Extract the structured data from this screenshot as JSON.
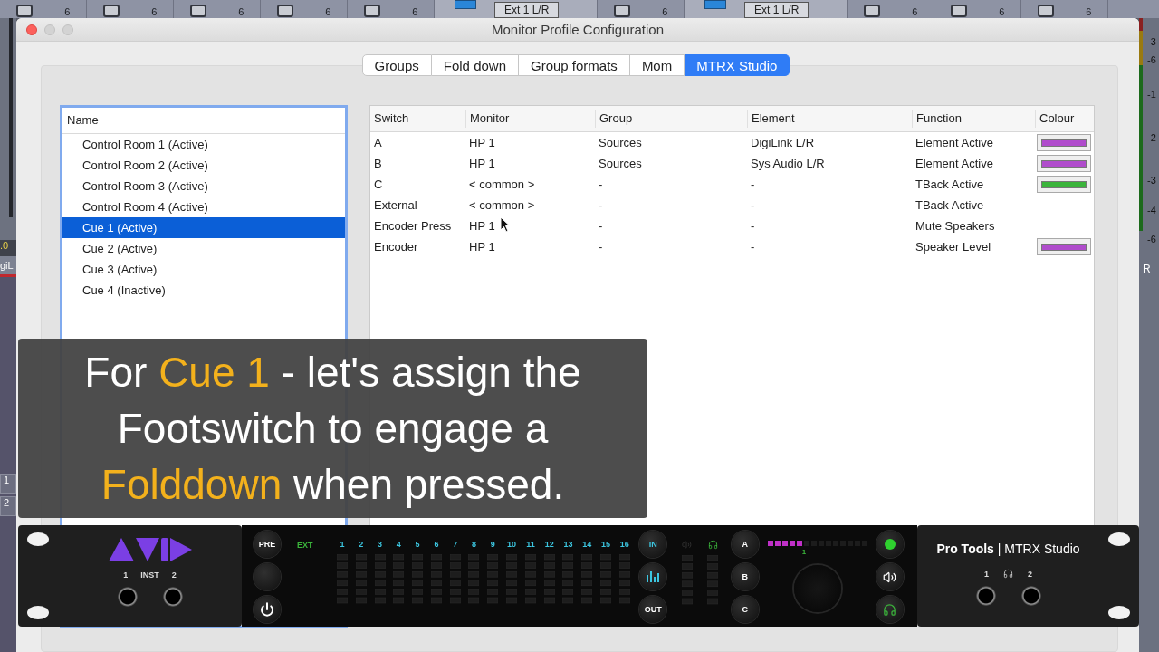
{
  "background": {
    "top_strip": [
      {
        "kind": "channel",
        "value": "6"
      },
      {
        "kind": "channel",
        "value": "6"
      },
      {
        "kind": "channel",
        "value": "6"
      },
      {
        "kind": "channel",
        "value": "6"
      },
      {
        "kind": "channel",
        "value": "6"
      },
      {
        "kind": "insert",
        "label": "Ext 1 L/R"
      },
      {
        "kind": "channel",
        "value": "6"
      },
      {
        "kind": "insert",
        "label": "Ext 1 L/R"
      },
      {
        "kind": "channel",
        "value": "6"
      },
      {
        "kind": "channel",
        "value": "6"
      },
      {
        "kind": "channel",
        "value": "6"
      }
    ],
    "left_strip": {
      "reading": ".0",
      "name": "giL",
      "buttons": [
        "1",
        "2"
      ]
    },
    "right_strip": {
      "scale": [
        "-3",
        "-6",
        "-1",
        "-2",
        "-3",
        "-4",
        "-6"
      ],
      "name": "R"
    }
  },
  "window": {
    "title": "Monitor Profile Configuration"
  },
  "tabs": [
    {
      "label": "Groups",
      "selected": false
    },
    {
      "label": "Fold down",
      "selected": false
    },
    {
      "label": "Group formats",
      "selected": false
    },
    {
      "label": "Mom",
      "selected": false
    },
    {
      "label": "MTRX Studio",
      "selected": true
    }
  ],
  "profiles": {
    "header": "Name",
    "items": [
      {
        "label": "Control Room 1 (Active)",
        "selected": false
      },
      {
        "label": "Control Room 2 (Active)",
        "selected": false
      },
      {
        "label": "Control Room 3 (Active)",
        "selected": false
      },
      {
        "label": "Control Room 4 (Active)",
        "selected": false
      },
      {
        "label": "Cue 1 (Active)",
        "selected": true
      },
      {
        "label": "Cue 2 (Active)",
        "selected": false
      },
      {
        "label": "Cue 3 (Active)",
        "selected": false
      },
      {
        "label": "Cue 4 (Inactive)",
        "selected": false
      }
    ]
  },
  "table": {
    "columns": [
      "Switch",
      "Monitor",
      "Group",
      "Element",
      "Function",
      "Colour"
    ],
    "rows": [
      {
        "cells": [
          "A",
          "HP 1",
          "Sources",
          "DigiLink L/R",
          "Element Active"
        ],
        "color": "#b04ccc"
      },
      {
        "cells": [
          "B",
          "HP 1",
          "Sources",
          "Sys Audio L/R",
          "Element Active"
        ],
        "color": "#b04ccc"
      },
      {
        "cells": [
          "C",
          "< common >",
          "-",
          "-",
          "TBack Active"
        ],
        "color": "#3bb43b"
      },
      {
        "cells": [
          "External",
          "< common >",
          "-",
          "-",
          "TBack Active"
        ]
      },
      {
        "cells": [
          "Encoder Press",
          "HP 1",
          "-",
          "-",
          "Mute Speakers"
        ]
      },
      {
        "cells": [
          "Encoder",
          "HP 1",
          "-",
          "-",
          "Speaker Level"
        ],
        "color": "#b04ccc"
      }
    ]
  },
  "caption": {
    "lines": [
      [
        {
          "text": "For ",
          "highlight": false
        },
        {
          "text": "Cue 1",
          "highlight": true
        },
        {
          "text": " - let's assign the",
          "highlight": false
        }
      ],
      [
        {
          "text": "Footswitch to engage a",
          "highlight": false
        }
      ],
      [
        {
          "text": "Folddown",
          "highlight": true
        },
        {
          "text": " when pressed.",
          "highlight": false
        }
      ]
    ]
  },
  "device": {
    "inst_labels": [
      "1",
      "INST",
      "2"
    ],
    "left_buttons": [
      "PRE"
    ],
    "input_label": "EXT",
    "channels": [
      "1",
      "2",
      "3",
      "4",
      "5",
      "6",
      "7",
      "8",
      "9",
      "10",
      "11",
      "12",
      "13",
      "14",
      "15",
      "16"
    ],
    "mode_buttons": [
      "IN",
      "OUT"
    ],
    "speaker_buttons": [
      "A",
      "B",
      "C"
    ],
    "level": 0.36,
    "level_label": "1",
    "brand": "**Pro Tools** | MTRX Studio",
    "headphone_labels": [
      "1",
      "2"
    ]
  }
}
